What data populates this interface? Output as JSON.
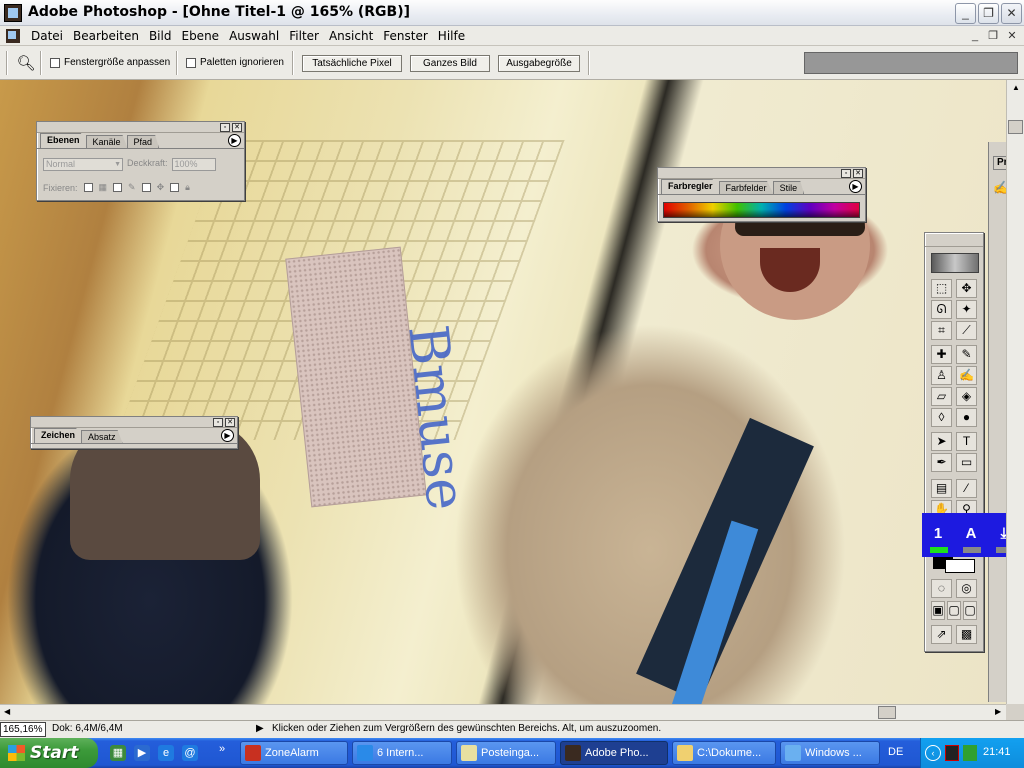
{
  "window": {
    "title": "Adobe Photoshop - [Ohne Titel-1 @ 165% (RGB)]",
    "controls": {
      "minimize": "_",
      "restore": "❐",
      "close": "✕"
    }
  },
  "menu": {
    "items": [
      "Datei",
      "Bearbeiten",
      "Bild",
      "Ebene",
      "Auswahl",
      "Filter",
      "Ansicht",
      "Fenster",
      "Hilfe"
    ],
    "mdi": {
      "minimize": "_",
      "restore": "❐",
      "close": "✕"
    }
  },
  "options_bar": {
    "tool_icon": "zoom-icon",
    "fit_window_label": "Fenstergröße anpassen",
    "ignore_palettes_label": "Paletten ignorieren",
    "actual_pixels_label": "Tatsächliche Pixel",
    "fit_screen_label": "Ganzes Bild",
    "print_size_label": "Ausgabegröße"
  },
  "layers_panel": {
    "tabs": [
      "Ebenen",
      "Kanäle",
      "Pfad"
    ],
    "active_tab": "Ebenen",
    "blend_mode": "Normal",
    "opacity_label": "Deckkraft:",
    "opacity_value": "100%",
    "lock_label": "Fixieren:"
  },
  "color_panel": {
    "tabs": [
      "Farbregler",
      "Farbfelder",
      "Stile"
    ],
    "active_tab": "Farbregler"
  },
  "character_panel": {
    "tabs": [
      "Zeichen",
      "Absatz"
    ],
    "active_tab": "Zeichen"
  },
  "protocol_panel": {
    "tab_label": "Prot"
  },
  "image_text": {
    "bottle_scrawl": "Bmuse"
  },
  "toolbox": {
    "tools": [
      "marquee-tool",
      "move-tool",
      "lasso-tool",
      "magic-wand-tool",
      "crop-tool",
      "slice-tool",
      "healing-brush-tool",
      "brush-tool",
      "clone-stamp-tool",
      "history-brush-tool",
      "eraser-tool",
      "paint-bucket-tool",
      "blur-tool",
      "dodge-tool",
      "path-selection-tool",
      "type-tool",
      "pen-tool",
      "shape-tool",
      "notes-tool",
      "eyedropper-tool",
      "hand-tool",
      "zoom-tool"
    ],
    "type_glyph": "T"
  },
  "zonealarm_bar": {
    "items": [
      "1",
      "A",
      "⤓"
    ]
  },
  "statusbar": {
    "zoom": "165,16%",
    "doc_info": "Dok: 6,4M/6,4M",
    "message": "Klicken oder Ziehen zum Vergrößern des gewünschten Bereichs. Alt, um auszuzoomen."
  },
  "taskbar": {
    "start_label": "Start",
    "tasks": [
      {
        "label": "ZoneAlarm",
        "icon": "zonealarm-icon"
      },
      {
        "label": "6 Intern...",
        "icon": "internet-explorer-icon"
      },
      {
        "label": "Posteinga...",
        "icon": "mail-icon"
      },
      {
        "label": "Adobe Pho...",
        "icon": "photoshop-icon"
      },
      {
        "label": "C:\\Dokume...",
        "icon": "folder-icon"
      },
      {
        "label": "Windows ...",
        "icon": "media-player-icon"
      }
    ],
    "language": "DE",
    "clock": "21:41"
  },
  "colors": {
    "taskbar_blue": "#245edb",
    "start_green": "#3c9a3a",
    "zonealarm_blue": "#1d1ae0",
    "panel_gray": "#d4d0c8"
  }
}
